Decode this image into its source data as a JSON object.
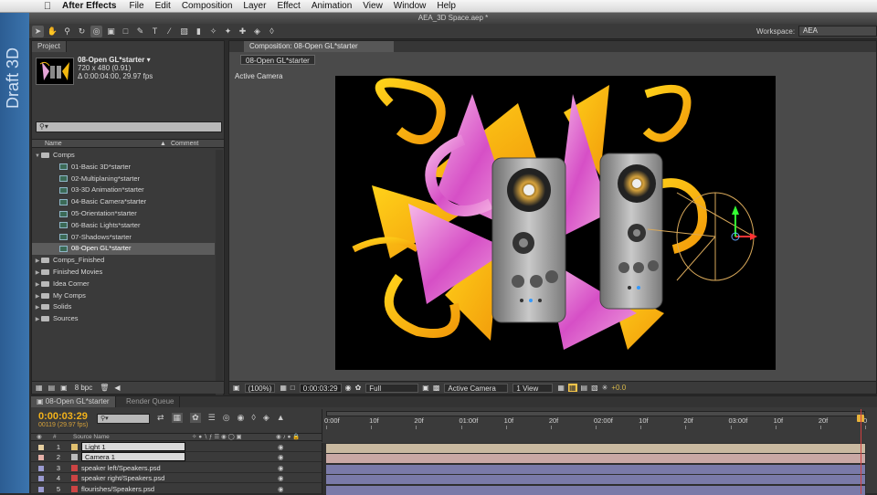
{
  "menubar": {
    "app_name": "After Effects",
    "items": [
      "File",
      "Edit",
      "Composition",
      "Layer",
      "Effect",
      "Animation",
      "View",
      "Window",
      "Help"
    ]
  },
  "side_strip": {
    "label": "Draft 3D"
  },
  "window": {
    "title": "AEA_3D Space.aep *"
  },
  "toolbar": {
    "tools": [
      "selection",
      "hand",
      "zoom",
      "rotation",
      "orbit-camera",
      "pan-behind",
      "rectangle-mask",
      "pen",
      "type",
      "brush",
      "clone-stamp",
      "eraser",
      "roto-brush",
      "puppet-pin",
      "local-axis",
      "world-axis",
      "view-axis"
    ],
    "workspace_label": "Workspace:",
    "workspace_value": "AEA"
  },
  "project": {
    "tab_label": "Project",
    "selected_name": "08-Open GL*starter ▾",
    "selected_dims": "720 x 480 (0.91)",
    "selected_duration": "Δ 0:00:04:00, 29.97 fps",
    "search_placeholder": "",
    "columns": {
      "name": "Name",
      "comment": "Comment"
    },
    "tree": [
      {
        "label": "Comps",
        "type": "folder",
        "indent": 0,
        "open": true
      },
      {
        "label": "01-Basic 3D*starter",
        "type": "comp",
        "indent": 1
      },
      {
        "label": "02-Multiplaning*starter",
        "type": "comp",
        "indent": 1
      },
      {
        "label": "03-3D Animation*starter",
        "type": "comp",
        "indent": 1
      },
      {
        "label": "04-Basic Camera*starter",
        "type": "comp",
        "indent": 1
      },
      {
        "label": "05-Orientation*starter",
        "type": "comp",
        "indent": 1
      },
      {
        "label": "06-Basic Lights*starter",
        "type": "comp",
        "indent": 1
      },
      {
        "label": "07-Shadows*starter",
        "type": "comp",
        "indent": 1
      },
      {
        "label": "08-Open GL*starter",
        "type": "comp",
        "indent": 1,
        "selected": true
      },
      {
        "label": "Comps_Finished",
        "type": "folder",
        "indent": 0
      },
      {
        "label": "Finished Movies",
        "type": "folder",
        "indent": 0
      },
      {
        "label": "Idea Corner",
        "type": "folder",
        "indent": 0
      },
      {
        "label": "My Comps",
        "type": "folder",
        "indent": 0
      },
      {
        "label": "Solids",
        "type": "folder",
        "indent": 0
      },
      {
        "label": "Sources",
        "type": "folder",
        "indent": 0
      }
    ],
    "bit_depth": "8 bpc"
  },
  "composition": {
    "tab_label": "Composition: 08-Open GL*starter",
    "breadcrumb": "08-Open GL*starter",
    "view_label": "Active Camera",
    "footer": {
      "zoom": "(100%)",
      "timecode": "0:00:03:29",
      "resolution": "Full",
      "camera": "Active Camera",
      "views": "1 View",
      "exposure": "+0.0"
    }
  },
  "timeline": {
    "tab_label": "08-Open GL*starter",
    "render_queue_label": "Render Queue",
    "timecode": "0:00:03:29",
    "frames": "00119 (29.97 fps)",
    "header": {
      "num": "#",
      "source_name": "Source Name"
    },
    "layers": [
      {
        "num": "1",
        "name": "Light 1",
        "color": "#e6cfa0",
        "kind": "light",
        "boxed": true
      },
      {
        "num": "2",
        "name": "Camera 1",
        "color": "#e6b0a8",
        "kind": "camera",
        "boxed": true
      },
      {
        "num": "3",
        "name": "speaker left/Speakers.psd",
        "color": "#9a9ad0",
        "kind": "psd"
      },
      {
        "num": "4",
        "name": "speaker right/Speakers.psd",
        "color": "#9a9ad0",
        "kind": "psd"
      },
      {
        "num": "5",
        "name": "flourishes/Speakers.psd",
        "color": "#9a9ad0",
        "kind": "psd"
      }
    ],
    "ruler_labels": [
      "0:00f",
      "10f",
      "20f",
      "01:00f",
      "10f",
      "20f",
      "02:00f",
      "10f",
      "20f",
      "03:00f",
      "10f",
      "20f",
      "0"
    ],
    "playhead_seconds": 3.97,
    "duration_seconds": 4.0
  }
}
